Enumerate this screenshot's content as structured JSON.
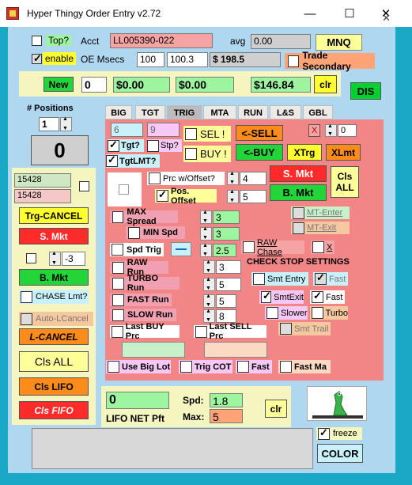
{
  "window": {
    "title": "Hyper Thingy Order Entry v2.72",
    "min": "—",
    "max": "☐",
    "close": "✕",
    "right_close": "✕"
  },
  "top": {
    "top_label": "Top?",
    "acct_label": "Acct",
    "acct_value": "LL005390-022",
    "avg_label": "avg",
    "avg_value": "0.00",
    "symbol": "MNQ",
    "enable_label": "enable",
    "oe_msecs_label": "OE Msecs",
    "msecs_1": "100",
    "msecs_2": "100.3",
    "balance": "$ 198.5",
    "trade_secondary": "Trade Secondary"
  },
  "pnl_row": {
    "new_label": "New",
    "qty": "0",
    "pnl1": "$0.00",
    "pnl2": "$0.00",
    "pnl3": "$146.84",
    "clr": "clr",
    "dis": "DIS"
  },
  "left": {
    "positions_label": "# Positions",
    "positions_value": "1",
    "big_count": "0",
    "price1": "15428",
    "price2": "15428",
    "trg_cancel": "Trg-CANCEL",
    "s_mkt": "S. Mkt",
    "qty_spin": "-3",
    "b_mkt": "B. Mkt",
    "chase_lmt": "CHASE Lmt?",
    "auto_lcancel": "Auto-LCancel",
    "l_cancel": "L-CANCEL",
    "cls_all": "Cls ALL",
    "cls_lifo": "Cls LIFO",
    "cls_fifo": "Cls FIFO"
  },
  "tabs": [
    "BIG",
    "TGT",
    "TRIG",
    "MTA",
    "RUN",
    "L&S",
    "GBL"
  ],
  "trig": {
    "box6": "6",
    "box9": "9",
    "sel": "SEL !",
    "sell": "<-SELL",
    "x_label": "X",
    "x_val": "0",
    "tgt": "Tgt?",
    "stp": "Stp?",
    "buy_q": "BUY !",
    "buy": "<-BUY",
    "xtrg": "XTrg",
    "xlmt": "XLmt",
    "tgtlmt": "TgtLMT?",
    "prc_offset": "Prc w/Offset?",
    "prc_offset_val": "4",
    "s_mkt": "S. Mkt",
    "cls_all": "Cls\nALL",
    "pos_offset": "Pos. Offset",
    "pos_offset_val": "5",
    "b_mkt": "B. Mkt",
    "max_spread": "MAX Spread",
    "max_spread_val": "3",
    "mt_enter": "MT-Enter",
    "min_spd": "MIN Spd",
    "min_spd_val": "3",
    "mt_exit": "MT-Exit",
    "spd_trig": "Spd Trig",
    "spd_trig_val": "2.5",
    "raw_chase": "RAW Chase",
    "x2": "X",
    "raw_run": "RAW Run",
    "raw_run_val": "3",
    "check_stop": "CHECK STOP SETTINGS",
    "turbo_run": "TURBO Run",
    "turbo_run_val": "5",
    "smt_entry": "Smt Entry",
    "fast1": "Fast",
    "fast_run": "FAST Run",
    "fast_run_val": "5",
    "smt_exit": "SmtExit",
    "fast2": "Fast",
    "slow_run": "SLOW Run",
    "slow_run_val": "8",
    "slower": "Slower",
    "turbo": "Turbo",
    "smt_trail": "Smt Trail",
    "last_buy": "Last BUY Prc",
    "last_sell": "Last SELL Prc",
    "use_big_lot": "Use Big Lot",
    "trig_cot": "Trig COT",
    "fast3": "Fast",
    "fast_ma": "Fast Ma"
  },
  "bottom": {
    "lifo_val": "0",
    "lifo_label": "LIFO NET Pft",
    "spd_label": "Spd:",
    "spd_val": "1.8",
    "max_label": "Max:",
    "max_val": "5",
    "clr": "clr",
    "freeze": "freeze",
    "color": "COLOR"
  },
  "colors": {
    "bg": "#19a9c6",
    "panel": "#afd7f0",
    "trig_panel": "#f28585",
    "green": "#22d63a",
    "red": "#ff2a2a",
    "yellow": "#ffff70"
  }
}
